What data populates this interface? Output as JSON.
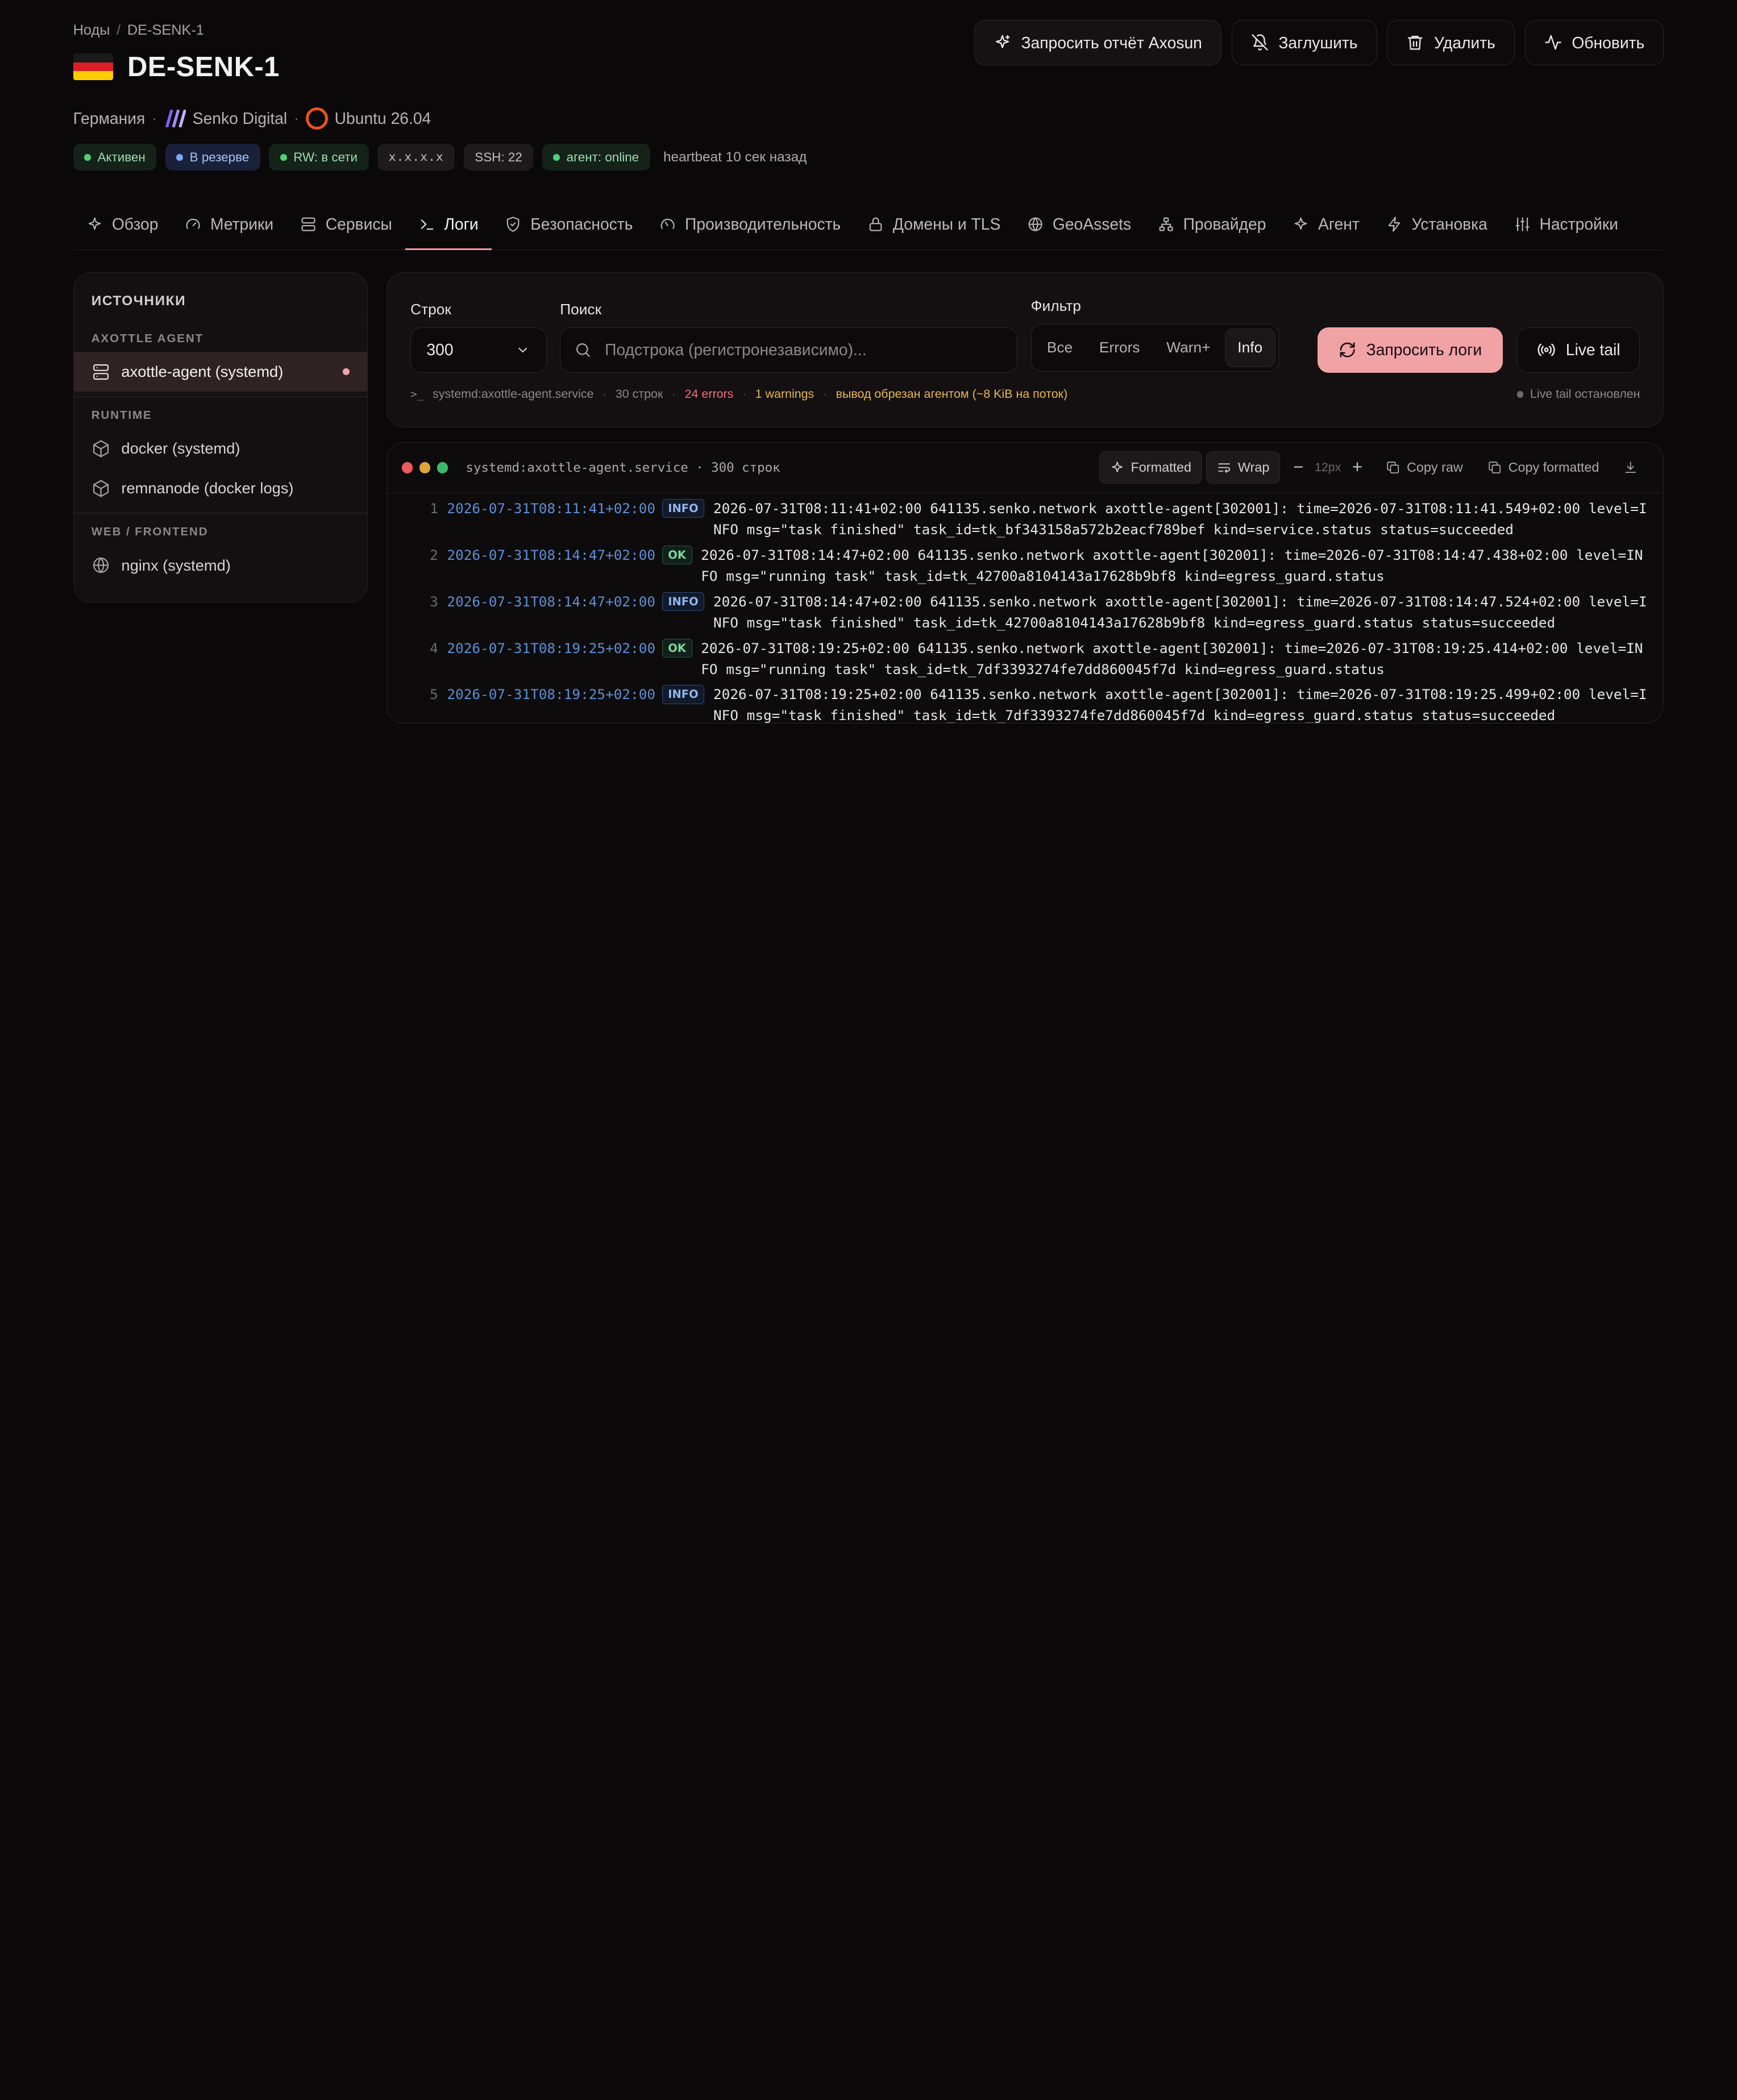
{
  "breadcrumb": {
    "parent": "Ноды",
    "separator": "/",
    "current": "DE-SENK-1"
  },
  "node": {
    "title": "DE-SENK-1",
    "country": "Германия",
    "provider": "Senko Digital",
    "os": "Ubuntu 26.04",
    "badges": {
      "active": "Активен",
      "reserve": "В резерве",
      "rw": "RW: в сети",
      "ip": "x.x.x.x",
      "ssh": "SSH: 22",
      "agent": "агент: online"
    },
    "heartbeat": "heartbeat 10 сек назад"
  },
  "actions": {
    "report": "Запросить отчёт Axosun",
    "mute": "Заглушить",
    "delete": "Удалить",
    "refresh": "Обновить"
  },
  "tabs": {
    "overview": "Обзор",
    "metrics": "Метрики",
    "services": "Сервисы",
    "logs": "Логи",
    "security": "Безопасность",
    "performance": "Производительность",
    "domains": "Домены и TLS",
    "geoassets": "GeoAssets",
    "provider": "Провайдер",
    "agent": "Агент",
    "install": "Установка",
    "settings": "Настройки"
  },
  "sources": {
    "title": "ИСТОЧНИКИ",
    "group_agent": "AXOTTLE AGENT",
    "agent_item": "axottle-agent (systemd)",
    "group_runtime": "RUNTIME",
    "docker_item": "docker (systemd)",
    "remnanode_item": "remnanode (docker logs)",
    "group_web": "WEB / FRONTEND",
    "nginx_item": "nginx (systemd)"
  },
  "controls": {
    "rows_label": "Строк",
    "rows_value": "300",
    "search_label": "Поиск",
    "search_placeholder": "Подстрока (регистронезависимо)...",
    "filter_label": "Фильтр",
    "filter_all": "Все",
    "filter_errors": "Errors",
    "filter_warn": "Warn+",
    "filter_info": "Info",
    "fetch_button": "Запросить логи",
    "live_button": "Live tail",
    "status": {
      "unit": "systemd:axottle-agent.service",
      "lines": "30 строк",
      "errors": "24 errors",
      "warnings": "1 warnings",
      "truncated": "вывод обрезан агентом (~8 KiB на поток)",
      "live": "Live tail остановлен"
    }
  },
  "terminal": {
    "title": "systemd:axottle-agent.service · 300 строк",
    "formatted": "Formatted",
    "wrap": "Wrap",
    "font_size": "12px",
    "copy_raw": "Copy raw",
    "copy_formatted": "Copy formatted",
    "lines": [
      {
        "n": "1",
        "ts": "2026-07-31T08:11:41+02:00",
        "level": "INFO",
        "msg": "2026-07-31T08:11:41+02:00 641135.senko.network axottle-agent[302001]: time=2026-07-31T08:11:41.549+02:00 level=INFO msg=\"task finished\" task_id=tk_bf343158a572b2eacf789bef kind=service.status status=succeeded"
      },
      {
        "n": "2",
        "ts": "2026-07-31T08:14:47+02:00",
        "level": "OK",
        "msg": "2026-07-31T08:14:47+02:00 641135.senko.network axottle-agent[302001]: time=2026-07-31T08:14:47.438+02:00 level=INFO msg=\"running task\" task_id=tk_42700a8104143a17628b9bf8 kind=egress_guard.status"
      },
      {
        "n": "3",
        "ts": "2026-07-31T08:14:47+02:00",
        "level": "INFO",
        "msg": "2026-07-31T08:14:47+02:00 641135.senko.network axottle-agent[302001]: time=2026-07-31T08:14:47.524+02:00 level=INFO msg=\"task finished\" task_id=tk_42700a8104143a17628b9bf8 kind=egress_guard.status status=succeeded"
      },
      {
        "n": "4",
        "ts": "2026-07-31T08:19:25+02:00",
        "level": "OK",
        "msg": "2026-07-31T08:19:25+02:00 641135.senko.network axottle-agent[302001]: time=2026-07-31T08:19:25.414+02:00 level=INFO msg=\"running task\" task_id=tk_7df3393274fe7dd860045f7d kind=egress_guard.status"
      },
      {
        "n": "5",
        "ts": "2026-07-31T08:19:25+02:00",
        "level": "INFO",
        "msg": "2026-07-31T08:19:25+02:00 641135.senko.network axottle-agent[302001]: time=2026-07-31T08:19:25.499+02:00 level=INFO msg=\"task finished\" task_id=tk_7df3393274fe7dd860045f7d kind=egress_guard.status status=succeeded"
      }
    ]
  },
  "colors": {
    "accent": "#f0a2a5",
    "background": "#0b0809",
    "timestamp": "#5c8fd6",
    "error": "#f0707b",
    "warning": "#e6b84c"
  }
}
